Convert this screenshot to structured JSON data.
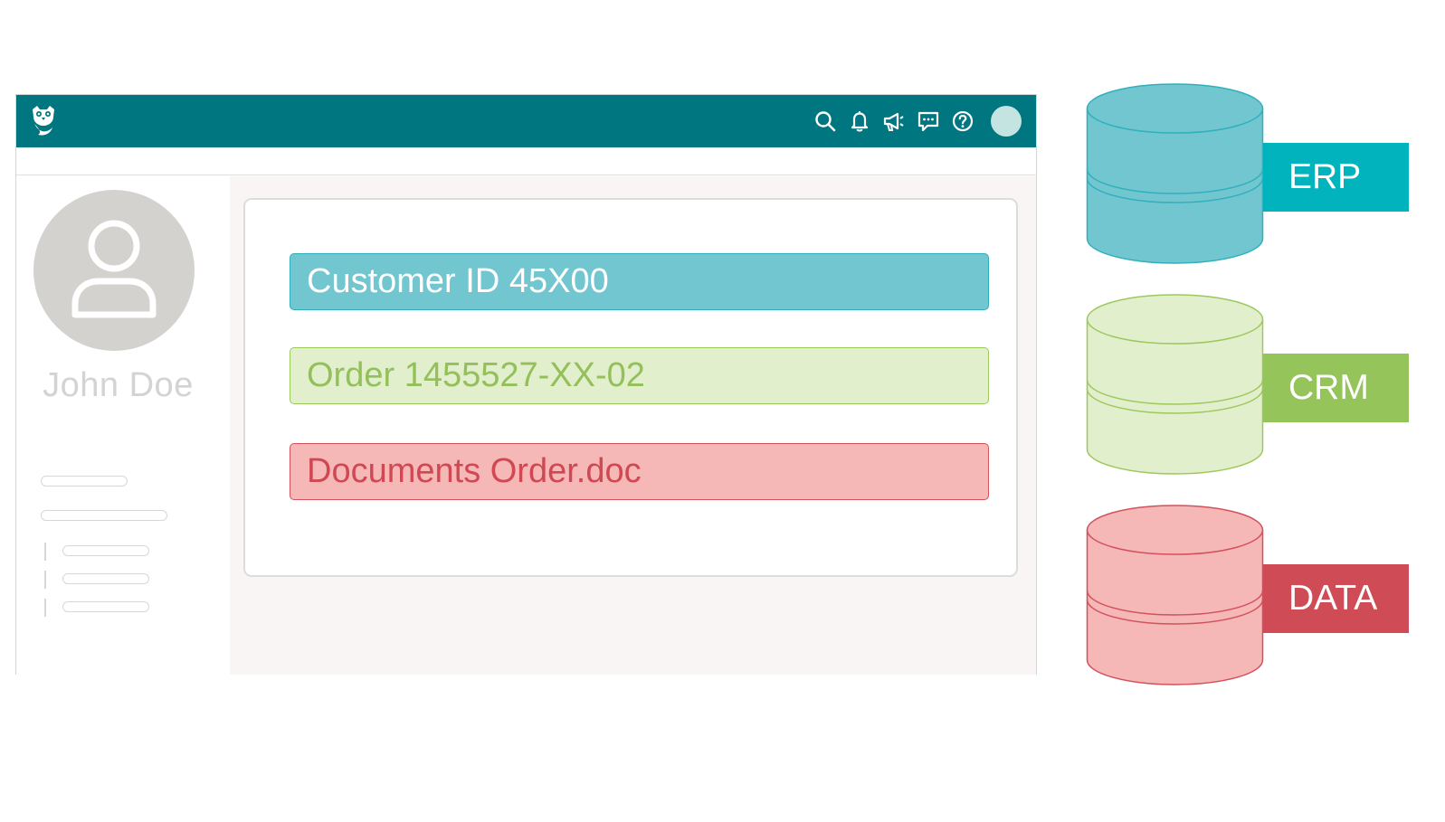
{
  "app": {
    "topbar_icons": [
      "search-icon",
      "bell-icon",
      "megaphone-icon",
      "chat-icon",
      "help-icon"
    ],
    "brand_color": "#007780"
  },
  "profile": {
    "name": "John Doe"
  },
  "fields": {
    "customer_id": "Customer ID 45X00",
    "order": "Order 1455527-XX-02",
    "document": "Documents Order.doc"
  },
  "databases": [
    {
      "label": "ERP",
      "color": "#00b3bd",
      "fill": "#72c6d0",
      "stroke": "#2eb0bd"
    },
    {
      "label": "CRM",
      "color": "#95c45b",
      "fill": "#e2efcd",
      "stroke": "#9cc85c"
    },
    {
      "label": "DATA",
      "color": "#cf4c56",
      "fill": "#f6b7b7",
      "stroke": "#d2515a"
    }
  ]
}
